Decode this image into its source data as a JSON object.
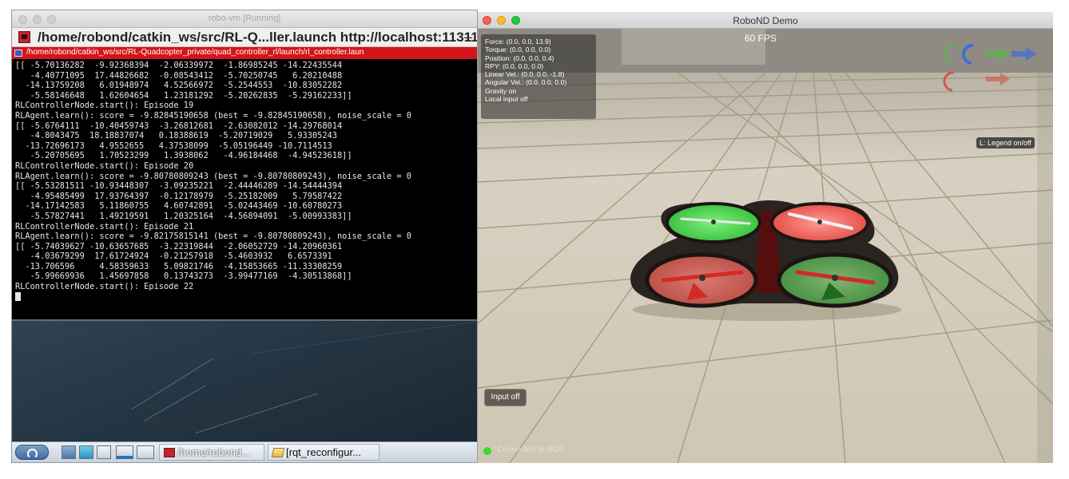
{
  "vm_window": {
    "title": "robo-vm [Running]"
  },
  "terminal": {
    "header_title": "/home/robond/catkin_ws/src/RL-Q...ller.launch http://localhost:11311",
    "header_min": "–",
    "tab_path": "/home/robond/catkin_ws/src/RL-Quadcopter_private/quad_controller_rl/launch/rl_controller.laun",
    "lines": [
      "[[ -5.70136282  -9.92368394  -2.06339972  -1.86985245 -14.22435544",
      "   -4.40771095  17.44826682  -0.08543412  -5.70250745   6.20210488",
      "  -14.13759208   6.01948974   4.52566972  -5.2544553  -10.83052282",
      "   -5.58146648   1.62604654   1.23181292  -5.20262835  -5.29162233]]",
      "RLControllerNode.start(): Episode 19",
      "RLAgent.learn(): score = -9.82845190658 (best = -9.82845190658), noise_scale = 0",
      "[[ -5.6764111  -10.40459743  -3.26812681  -2.63082012 -14.29768014",
      "   -4.8043475  18.18837074   0.18388619  -5.20719029   5.93305243",
      "  -13.72696173   4.9552655   4.37538099  -5.05196449 -10.7114513",
      "   -5.20705695   1.70523299   1.3938062   -4.96184468  -4.94523618]]",
      "RLControllerNode.start(): Episode 20",
      "RLAgent.learn(): score = -9.80780809243 (best = -9.80780809243), noise_scale = 0",
      "[[ -5.53281511 -10.93448307  -3.09235221  -2.44446289 -14.54444394",
      "   -4.95485499  17.93764397  -0.12178979  -5.25182009   5.79587422",
      "  -14.17142583   5.11860755   4.60742891  -5.02443469 -10.60780273",
      "   -5.57827441   1.49219591   1.20325164  -4.56894091  -5.00993383]]",
      "RLControllerNode.start(): Episode 21",
      "RLAgent.learn(): score = -9.82175815141 (best = -9.80780809243), noise_scale = 0",
      "[[ -5.74039627 -10.63657685  -3.22319844  -2.06052729 -14.20960361",
      "   -4.03679299  17.61724924  -0.21257918  -5.4603932   6.6573391",
      "  -13.706596     4.58359633   5.09821746  -4.15853665 -11.33308259",
      "   -5.99669936   1.45697858   0.13743273  -3.99477169  -4.30513868]]",
      "RLControllerNode.start(): Episode 22"
    ]
  },
  "taskbar": {
    "tasks": [
      {
        "label": "/home/robond..."
      },
      {
        "label": "[rqt_reconfigur..."
      }
    ]
  },
  "sim_window": {
    "title": "RoboND Demo",
    "fps": "60 FPS",
    "info_lines": [
      "Force: (0.0, 0.0, 13.9)",
      "Torque: (0.0, 0.0, 0.0)",
      "Position: (0.0, 0.0, 0.4)",
      "RPY: (0.0, 0.0, 0.0)",
      "Linear Vel.: (0.0, 0.0, -1.8)",
      "Angular Vel.: (0.0, 0.0, 0.0)",
      "Gravity on",
      "Local input off"
    ],
    "legend_button": "L: Legend on/off",
    "input_button": "Input off",
    "connection_status": "Connected to ROS"
  },
  "colors": {
    "terminal_bg": "#000000",
    "terminal_text": "#e6e6e6",
    "tab_red": "#d3151b",
    "floor": "#c9c1ad",
    "rotor_green": "#3fcf43",
    "rotor_red": "#e8473f",
    "drone_body": "#2a2420"
  }
}
